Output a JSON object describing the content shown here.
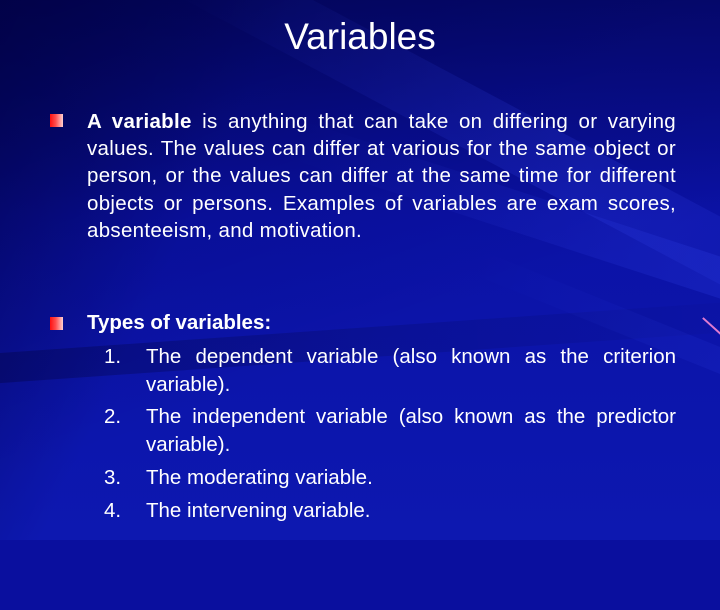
{
  "slide": {
    "title": "Variables",
    "bullets": [
      {
        "bold_lead": "A variable",
        "text": " is anything that can take on differing or varying values. The values can differ at various for the same object or person, or the values can differ at the same time for different objects or persons. Examples of variables are exam scores, absenteeism, and motivation."
      },
      {
        "heading": "Types of variables:",
        "items": [
          {
            "number": "1.",
            "text": "The dependent variable (also known as the criterion variable)."
          },
          {
            "number": "2.",
            "text": "The independent variable (also known as the predictor variable)."
          },
          {
            "number": "3.",
            "text": "The moderating variable."
          },
          {
            "number": "4.",
            "text": "The intervening variable."
          }
        ]
      }
    ]
  },
  "theme": {
    "background": "#0a0f9e",
    "text_color": "#ffffff",
    "bullet_color": "#ff1010",
    "accent_line": "#e07ad0"
  }
}
